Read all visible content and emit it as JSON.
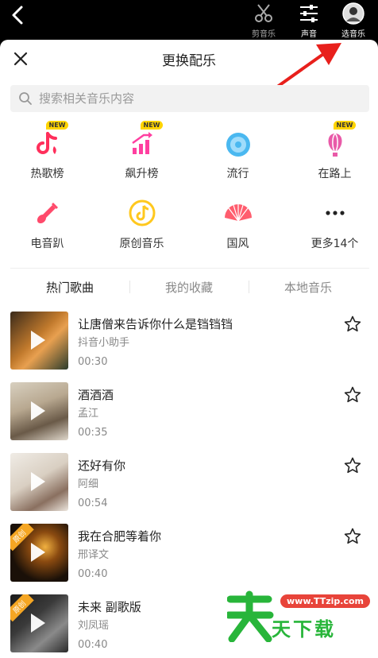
{
  "topbar": {
    "tools": [
      {
        "label": "剪音乐",
        "icon": "scissors-icon"
      },
      {
        "label": "声音",
        "icon": "sliders-icon"
      },
      {
        "label": "选音乐",
        "icon": "music-avatar-icon"
      }
    ]
  },
  "sheet": {
    "title": "更换配乐",
    "search_placeholder": "搜索相关音乐内容"
  },
  "categories": [
    {
      "name": "热歌榜",
      "icon": "tiktok-note-icon",
      "badge": "NEW",
      "color": "#ff2f5b"
    },
    {
      "name": "飙升榜",
      "icon": "rising-chart-icon",
      "badge": "NEW",
      "color": "#ff3fa0"
    },
    {
      "name": "流行",
      "icon": "disc-icon",
      "badge": "",
      "color": "#4ab8f0"
    },
    {
      "name": "在路上",
      "icon": "balloon-icon",
      "badge": "NEW",
      "color": "#e95aa8"
    },
    {
      "name": "电音趴",
      "icon": "guitar-icon",
      "badge": "",
      "color": "#ff4a6b"
    },
    {
      "name": "原创音乐",
      "icon": "original-music-icon",
      "badge": "",
      "color": "#ffc81e"
    },
    {
      "name": "国风",
      "icon": "fan-icon",
      "badge": "",
      "color": "#ff5d6e"
    },
    {
      "name": "更多14个",
      "icon": "more-icon",
      "badge": "",
      "color": "#222222"
    }
  ],
  "tabs": [
    {
      "label": "热门歌曲",
      "active": true
    },
    {
      "label": "我的收藏",
      "active": false
    },
    {
      "label": "本地音乐",
      "active": false
    }
  ],
  "songs": [
    {
      "title": "让唐僧来告诉你什么是铛铛铛",
      "artist": "抖音小助手",
      "duration": "00:30",
      "original": false
    },
    {
      "title": "酒酒酒",
      "artist": "孟江",
      "duration": "00:35",
      "original": false
    },
    {
      "title": "还好有你",
      "artist": "阿细",
      "duration": "00:54",
      "original": false
    },
    {
      "title": "我在合肥等着你",
      "artist": "邢译文",
      "duration": "00:40",
      "original": true
    },
    {
      "title": "未来 副歌版",
      "artist": "刘凤瑶",
      "duration": "00:40",
      "original": true
    }
  ],
  "original_badge": "原创",
  "watermark": {
    "url": "www.TTzip.com",
    "text": "天下载"
  }
}
